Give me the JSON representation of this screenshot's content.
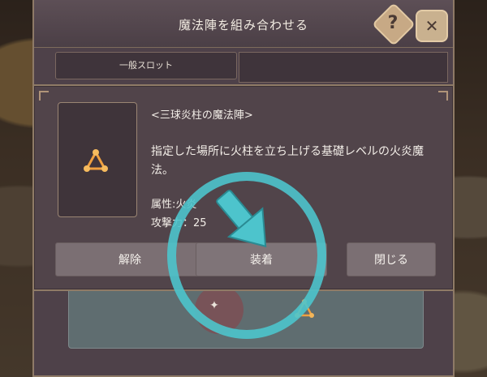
{
  "window": {
    "title": "魔法陣を組み合わせる",
    "help_label": "?",
    "close_label": "✕",
    "tab_general": "一般スロット"
  },
  "dialog": {
    "spell_name": "<三球炎柱の魔法陣>",
    "description": "指定した場所に火柱を立ち上げる基礎レベルの火炎魔法。",
    "attribute": "属性:火炎",
    "attack": "攻撃力：25",
    "buttons": {
      "release": "解除",
      "equip": "装着",
      "close": "閉じる"
    }
  },
  "icons": {
    "spell": "fire-triangle-icon",
    "slot_gear": "gear-icon",
    "tutorial": "arrow-pointer-icon"
  },
  "colors": {
    "accent_cyan": "#4dc4cc",
    "fire_orange": "#f0a040",
    "panel": "#51444a"
  }
}
